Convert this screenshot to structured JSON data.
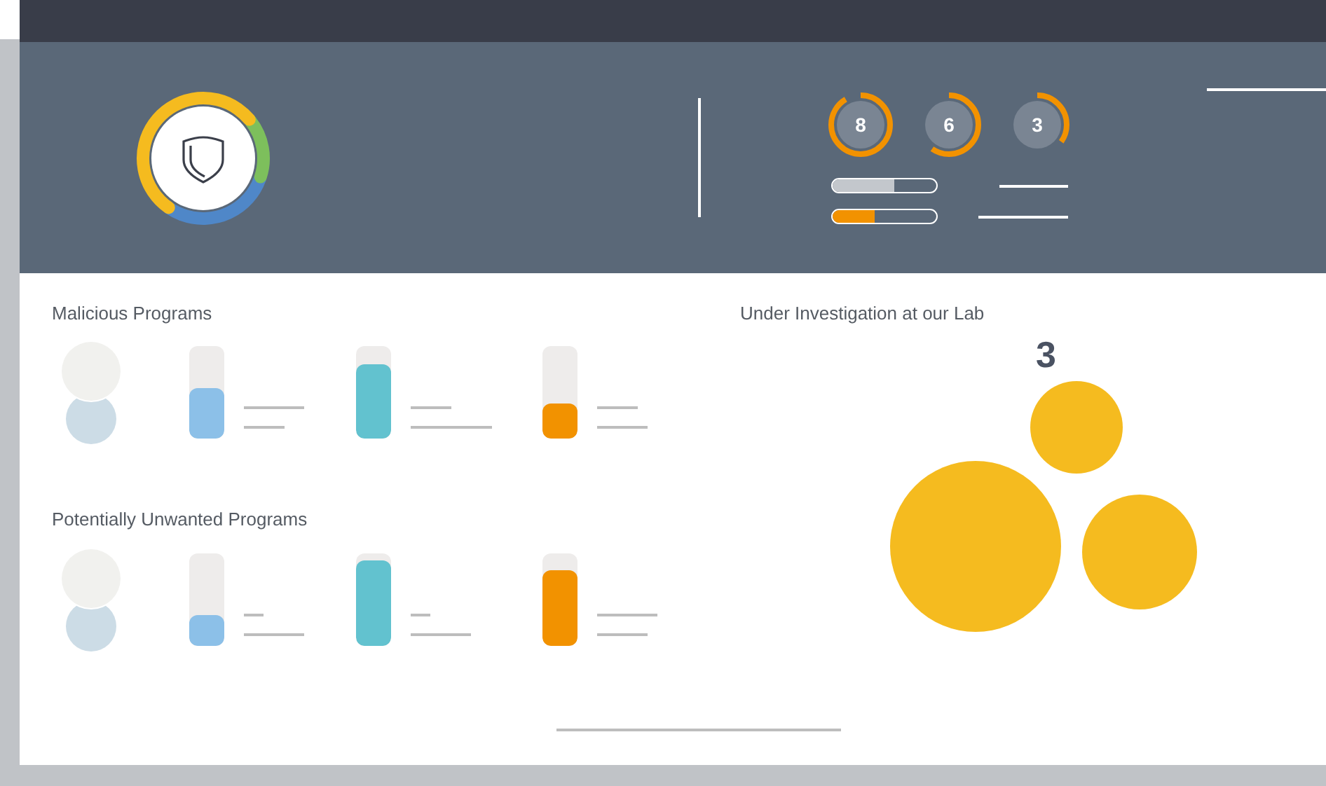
{
  "header": {
    "counters": [
      {
        "value": "8",
        "level": 0.92
      },
      {
        "value": "6",
        "level": 0.6
      },
      {
        "value": "3",
        "level": 0.35
      }
    ],
    "bars": [
      {
        "kind": "neutral",
        "level": 0.6
      },
      {
        "kind": "alert",
        "level": 0.4
      }
    ]
  },
  "sections": [
    {
      "title": "Malicious Programs",
      "bars": [
        {
          "color": "#8cc0e8",
          "level": 0.55
        },
        {
          "color": "#62c2cf",
          "level": 0.8
        },
        {
          "color": "#f29200",
          "level": 0.38
        }
      ]
    },
    {
      "title": "Potentially Unwanted Programs",
      "bars": [
        {
          "color": "#8cc0e8",
          "level": 0.33
        },
        {
          "color": "#62c2cf",
          "level": 0.92
        },
        {
          "color": "#f29200",
          "level": 0.82
        }
      ]
    }
  ],
  "lab": {
    "title": "Under Investigation at our Lab",
    "count": "3"
  }
}
